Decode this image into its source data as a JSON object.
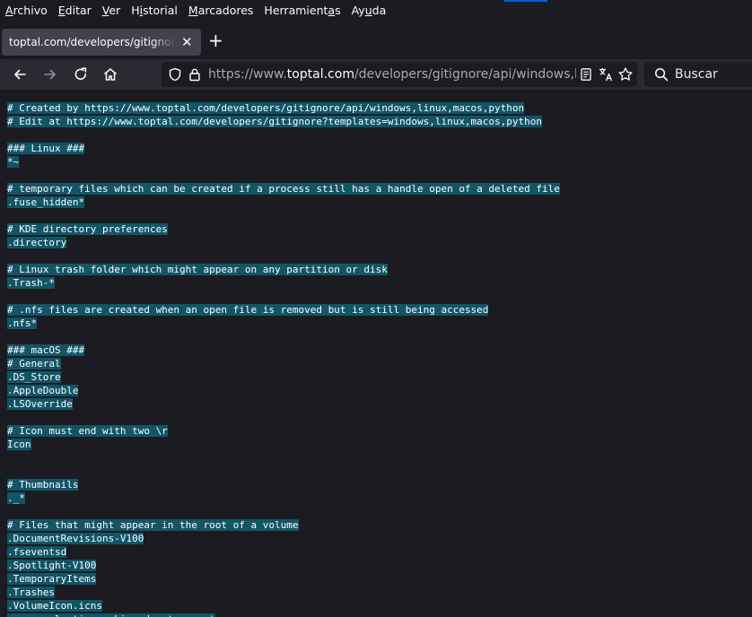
{
  "menu": {
    "items": [
      {
        "label": "Archivo",
        "u": 0
      },
      {
        "label": "Editar",
        "u": 0
      },
      {
        "label": "Ver",
        "u": 0
      },
      {
        "label": "Historial",
        "u": 1
      },
      {
        "label": "Marcadores",
        "u": 0
      },
      {
        "label": "Herramientas",
        "u": 10
      },
      {
        "label": "Ayuda",
        "u": 2
      }
    ]
  },
  "tab": {
    "title": "toptal.com/developers/gitignore/api/windows,linux,macos,python",
    "close_glyph": "✕",
    "new_tab_glyph": "+"
  },
  "navbar": {
    "url_prefix": "https://www.",
    "url_host": "toptal.com",
    "url_path": "/developers/gitignore/api/windows,linux,macos,python",
    "search_placeholder": "Buscar",
    "icons": [
      "back-arrow-icon",
      "forward-arrow-icon",
      "reload-icon",
      "home-icon",
      "shield-icon",
      "lock-icon",
      "reader-mode-icon",
      "translate-icon",
      "bookmark-star-icon",
      "search-icon"
    ]
  },
  "colors": {
    "selection": "#115567",
    "background": "#1c1b22",
    "toolbar": "#2b2a33"
  },
  "content": {
    "lines": [
      "# Created by https://www.toptal.com/developers/gitignore/api/windows,linux,macos,python",
      "# Edit at https://www.toptal.com/developers/gitignore?templates=windows,linux,macos,python",
      "",
      "### Linux ###",
      "*~",
      "",
      "# temporary files which can be created if a process still has a handle open of a deleted file",
      ".fuse_hidden*",
      "",
      "# KDE directory preferences",
      ".directory",
      "",
      "# Linux trash folder which might appear on any partition or disk",
      ".Trash-*",
      "",
      "# .nfs files are created when an open file is removed but is still being accessed",
      ".nfs*",
      "",
      "### macOS ###",
      "# General",
      ".DS_Store",
      ".AppleDouble",
      ".LSOverride",
      "",
      "# Icon must end with two \\r",
      "Icon",
      "",
      "",
      "# Thumbnails",
      "._*",
      "",
      "# Files that might appear in the root of a volume",
      ".DocumentRevisions-V100",
      ".fseventsd",
      ".Spotlight-V100",
      ".TemporaryItems",
      ".Trashes",
      ".VolumeIcon.icns",
      ".com.apple.timemachine.donotpresent"
    ]
  }
}
